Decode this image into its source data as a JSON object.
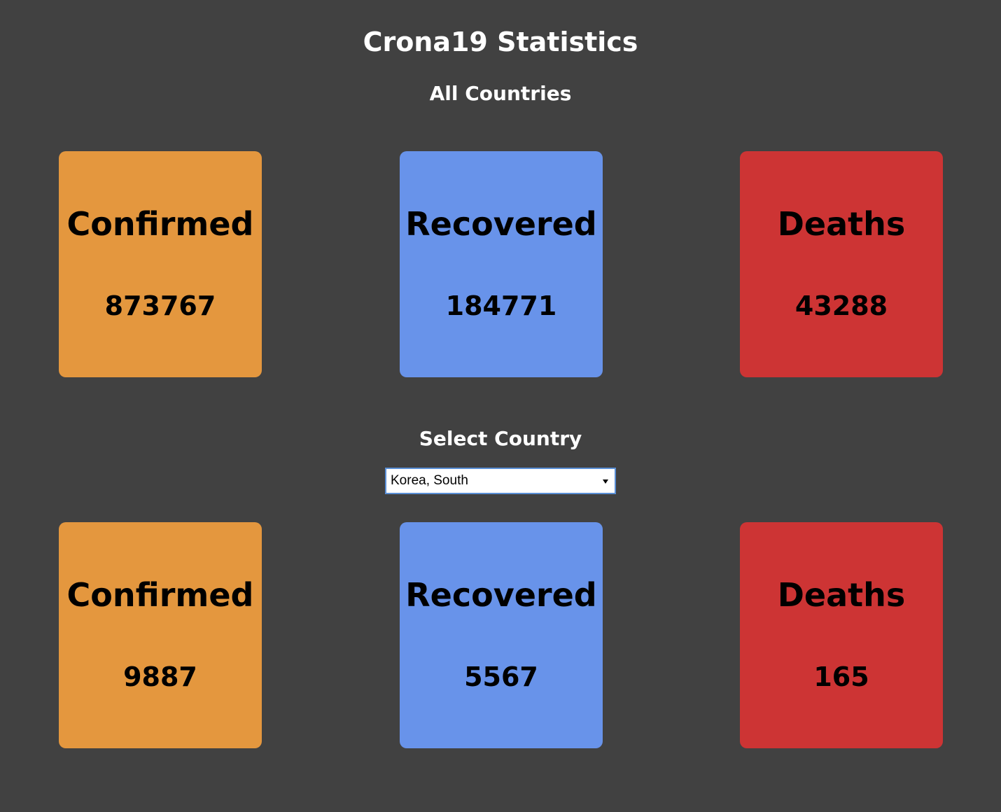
{
  "header": {
    "title": "Crona19 Statistics"
  },
  "global": {
    "title": "All Countries",
    "cards": {
      "confirmed": {
        "label": "Confirmed",
        "value": "873767",
        "color": "#e4973e"
      },
      "recovered": {
        "label": "Recovered",
        "value": "184771",
        "color": "#6893ea"
      },
      "deaths": {
        "label": "Deaths",
        "value": "43288",
        "color": "#cd3434"
      }
    }
  },
  "country": {
    "title": "Select Country",
    "select": {
      "selected": "Korea, South"
    },
    "cards": {
      "confirmed": {
        "label": "Confirmed",
        "value": "9887",
        "color": "#e4973e"
      },
      "recovered": {
        "label": "Recovered",
        "value": "5567",
        "color": "#6893ea"
      },
      "deaths": {
        "label": "Deaths",
        "value": "165",
        "color": "#cd3434"
      }
    }
  },
  "theme": {
    "background": "#414141",
    "heading_color": "#ffffff"
  }
}
